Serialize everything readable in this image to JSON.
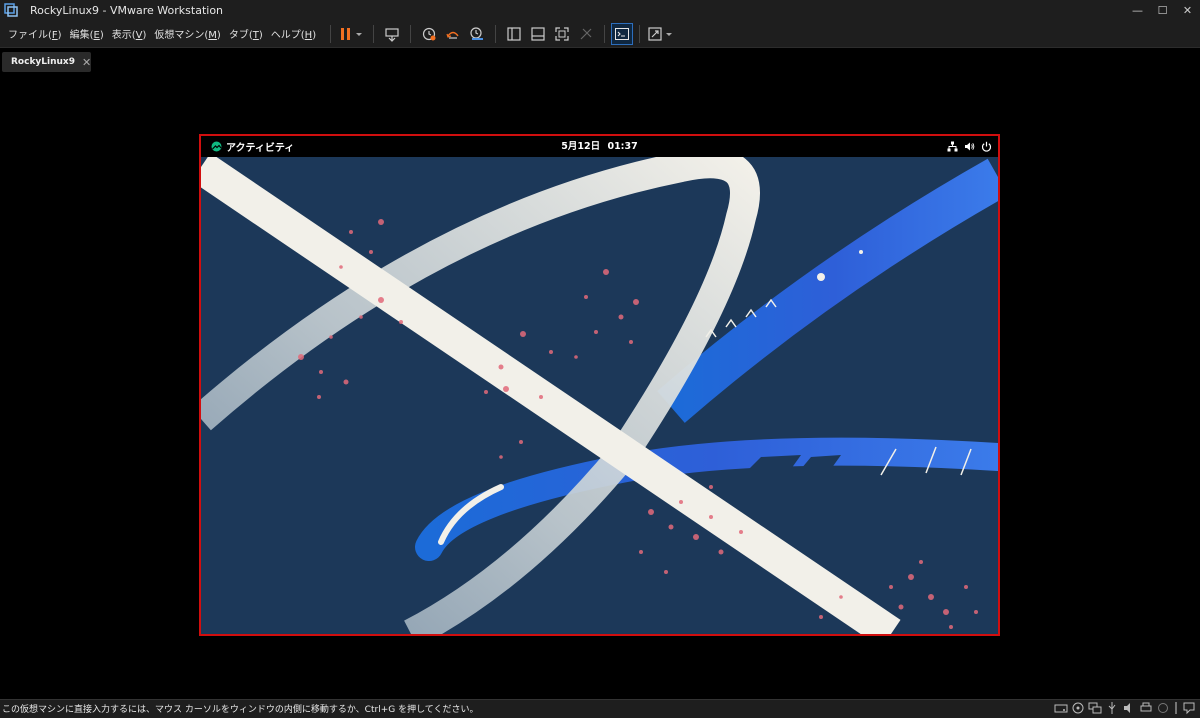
{
  "window": {
    "title": "RockyLinux9 - VMware Workstation",
    "minimize_glyph": "—",
    "maximize_glyph": "☐",
    "close_glyph": "✕"
  },
  "menu": {
    "items": [
      {
        "label": "ファイル",
        "key": "F"
      },
      {
        "label": "編集",
        "key": "E"
      },
      {
        "label": "表示",
        "key": "V"
      },
      {
        "label": "仮想マシン",
        "key": "M"
      },
      {
        "label": "タブ",
        "key": "T"
      },
      {
        "label": "ヘルプ",
        "key": "H"
      }
    ]
  },
  "toolbar": {
    "icons": [
      "pause-icon",
      "send-keys-icon",
      "snapshot-icon",
      "revert-snapshot-icon",
      "snapshot-manager-icon",
      "library-icon",
      "thumbnail-icon",
      "full-screen-icon",
      "unity-icon",
      "console-view-icon",
      "stretch-icon"
    ]
  },
  "tab": {
    "label": "RockyLinux9",
    "close_glyph": "✕"
  },
  "guest": {
    "activities_label": "アクティビティ",
    "clock_date": "5月12日",
    "clock_time": "01:37"
  },
  "status": {
    "message": "この仮想マシンに直接入力するには、マウス カーソルをウィンドウの内側に移動するか、Ctrl+G を押してください。"
  },
  "colors": {
    "accent_border": "#d10e0e",
    "pause_orange": "#f37021",
    "wallpaper_bg": "#1c3859",
    "ribbon": "#f2f0e9"
  }
}
